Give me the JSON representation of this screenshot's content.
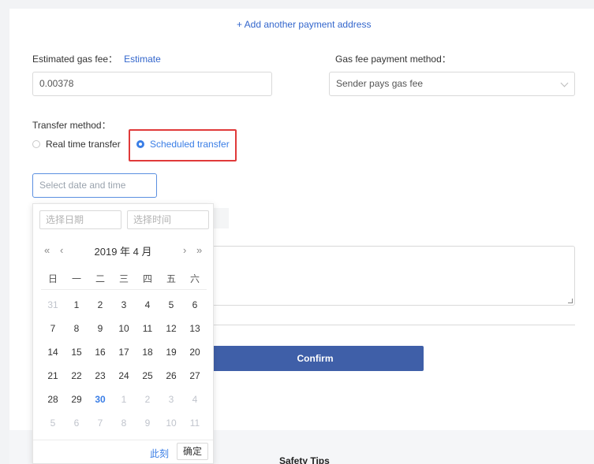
{
  "add_address": "+ Add another payment address",
  "gas": {
    "label": "Estimated gas fee：",
    "estimate_link": "Estimate",
    "value": "0.00378"
  },
  "payment_method": {
    "label": "Gas fee payment method：",
    "value": "Sender pays gas fee"
  },
  "transfer": {
    "label": "Transfer method：",
    "options": [
      {
        "label": "Real time transfer",
        "checked": false
      },
      {
        "label": "Scheduled transfer",
        "checked": true
      }
    ]
  },
  "datetime": {
    "placeholder": "Select date and time"
  },
  "picker": {
    "date_placeholder": "选择日期",
    "time_placeholder": "选择时间",
    "prev_year": "«",
    "prev_month": "‹",
    "next_month": "›",
    "next_year": "»",
    "title": "2019 年 4 月",
    "weekdays": [
      "日",
      "一",
      "二",
      "三",
      "四",
      "五",
      "六"
    ],
    "weeks": [
      [
        "31",
        "1",
        "2",
        "3",
        "4",
        "5",
        "6"
      ],
      [
        "7",
        "8",
        "9",
        "10",
        "11",
        "12",
        "13"
      ],
      [
        "14",
        "15",
        "16",
        "17",
        "18",
        "19",
        "20"
      ],
      [
        "21",
        "22",
        "23",
        "24",
        "25",
        "26",
        "27"
      ],
      [
        "28",
        "29",
        "30",
        "1",
        "2",
        "3",
        "4"
      ],
      [
        "5",
        "6",
        "7",
        "8",
        "9",
        "10",
        "11"
      ]
    ],
    "today": "30",
    "now_label": "此刻",
    "ok_label": "确定"
  },
  "confirm_label": "Confirm",
  "safety_title": "Safety Tips",
  "colors": {
    "accent": "#3a7ee6",
    "confirm": "#3f5fa8",
    "highlight": "#e03a3a"
  }
}
